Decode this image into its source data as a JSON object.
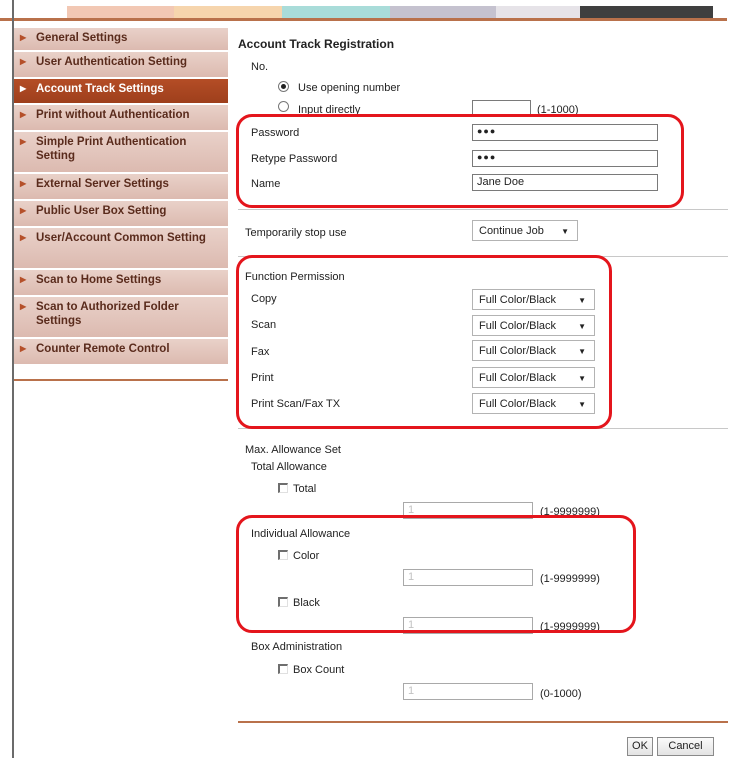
{
  "colors": {
    "strip": [
      "#f2c8b4",
      "#f6d5ad",
      "#a9dcd9",
      "#c5c2cf",
      "#cbc5d6",
      "#e6e3e8",
      "#3f3f3f"
    ],
    "nav_active": "#a8431f",
    "annotation_red": "#e4151c"
  },
  "sidebar": {
    "items": [
      {
        "label": "General Settings"
      },
      {
        "label": "User Authentication Setting"
      },
      {
        "label": "Account Track Settings"
      },
      {
        "label": "Print without Authentication"
      },
      {
        "label": "Simple Print Authentication Setting"
      },
      {
        "label": "External Server Settings"
      },
      {
        "label": "Public User Box Setting"
      },
      {
        "label": "User/Account Common Setting"
      },
      {
        "label": "Scan to Home Settings"
      },
      {
        "label": "Scan to Authorized Folder Settings"
      },
      {
        "label": "Counter Remote Control"
      }
    ],
    "arrow_icon": "arrow-right-icon"
  },
  "form": {
    "title": "Account Track Registration",
    "no_label": "No.",
    "radio_opening": "Use opening number",
    "radio_direct": "Input directly",
    "direct_range": "(1-1000)",
    "password_label": "Password",
    "password_value": "●●●",
    "retype_label": "Retype Password",
    "retype_value": "●●●",
    "name_label": "Name",
    "name_value": "Jane Doe",
    "stop_label": "Temporarily stop use",
    "stop_value": "Continue Job",
    "function_title": "Function Permission",
    "functions": [
      {
        "label": "Copy",
        "value": "Full Color/Black"
      },
      {
        "label": "Scan",
        "value": "Full Color/Black"
      },
      {
        "label": "Fax",
        "value": "Full Color/Black"
      },
      {
        "label": "Print",
        "value": "Full Color/Black"
      },
      {
        "label": "Print Scan/Fax TX",
        "value": "Full Color/Black"
      }
    ],
    "max_title": "Max. Allowance Set",
    "total_title": "Total Allowance",
    "total_check": "Total",
    "total_value": "1",
    "total_range": "(1-9999999)",
    "individual_title": "Individual Allowance",
    "color_check": "Color",
    "color_value": "1",
    "color_range": "(1-9999999)",
    "black_check": "Black",
    "black_value": "1",
    "black_range": "(1-9999999)",
    "box_title": "Box Administration",
    "box_check": "Box Count",
    "box_value": "1",
    "box_range": "(0-1000)"
  },
  "buttons": {
    "ok": "OK",
    "cancel": "Cancel"
  }
}
